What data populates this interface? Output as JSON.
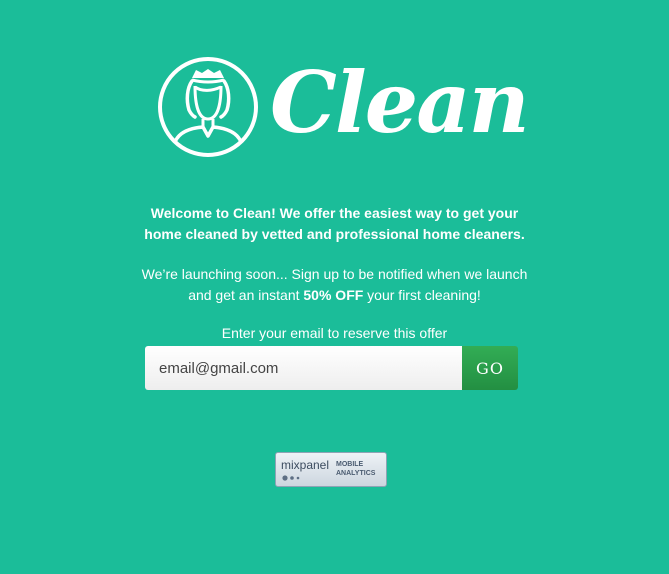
{
  "brand": {
    "name": "Clean"
  },
  "intro": {
    "line1": "Welcome to Clean! We offer the easiest way to get your",
    "line2": "home cleaned by vetted and professional home cleaners."
  },
  "launch": {
    "line1": "We’re launching soon... Sign up to be notified when we launch",
    "line2_pre": "and get an instant ",
    "line2_bold": "50% OFF",
    "line2_post": " your first cleaning!"
  },
  "signup": {
    "prompt": "Enter your email to reserve this offer",
    "email_value": "email@gmail.com",
    "submit_label": "GO"
  },
  "badge": {
    "brand": "mixpanel",
    "line1": "MOBILE",
    "line2": "ANALYTICS"
  },
  "colors": {
    "background": "#1bbd99",
    "button": "#2a9c4b",
    "text": "#ffffff"
  }
}
